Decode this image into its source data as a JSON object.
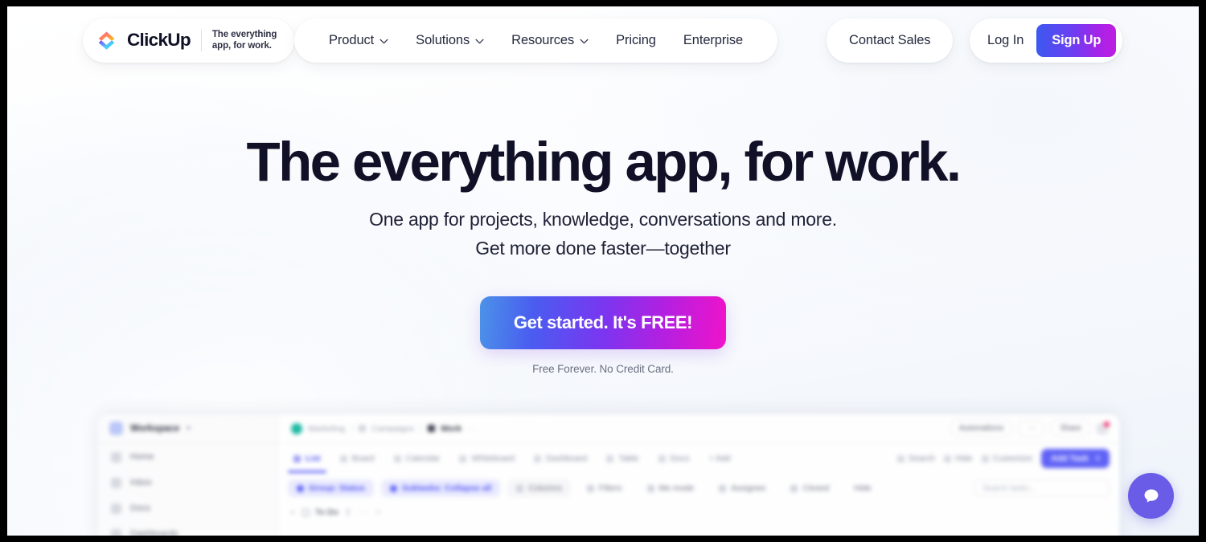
{
  "header": {
    "logo": {
      "icon": "clickup-logo-icon",
      "wordmark": "ClickUp",
      "tagline_line1": "The everything",
      "tagline_line2": "app, for work."
    },
    "nav_items": [
      {
        "label": "Product",
        "has_dropdown": true
      },
      {
        "label": "Solutions",
        "has_dropdown": true
      },
      {
        "label": "Resources",
        "has_dropdown": true
      },
      {
        "label": "Pricing",
        "has_dropdown": false
      },
      {
        "label": "Enterprise",
        "has_dropdown": false
      }
    ],
    "contact_sales": "Contact Sales",
    "log_in": "Log In",
    "sign_up": "Sign Up"
  },
  "hero": {
    "headline": "The everything app, for work.",
    "subhead_line1": "One app for projects, knowledge, conversations and more.",
    "subhead_line2": "Get more done faster—together",
    "cta_label": "Get started. It's FREE!",
    "cta_note": "Free Forever. No Credit Card."
  },
  "app_preview": {
    "workspace": {
      "name": "Workspace",
      "caret": "▾"
    },
    "sidebar_items": [
      {
        "label": "Home",
        "icon": "home-icon"
      },
      {
        "label": "Inbox",
        "icon": "inbox-icon"
      },
      {
        "label": "Docs",
        "icon": "docs-icon"
      },
      {
        "label": "Dashboards",
        "icon": "dashboards-icon"
      }
    ],
    "breadcrumb": [
      {
        "label": "Marketing",
        "bold": false
      },
      {
        "label": "Campaigns",
        "bold": false
      },
      {
        "label": "Work",
        "bold": true
      }
    ],
    "breadcrumb_separator": "/",
    "breadcrumb_more": "···",
    "header_actions": [
      {
        "label": "Automations"
      },
      {
        "label": "⋯"
      },
      {
        "label": "Share"
      }
    ],
    "tabs": [
      {
        "label": "List",
        "active": true
      },
      {
        "label": "Board",
        "active": false
      },
      {
        "label": "Calendar",
        "active": false
      },
      {
        "label": "Whiteboard",
        "active": false
      },
      {
        "label": "Dashboard",
        "active": false
      },
      {
        "label": "Table",
        "active": false
      },
      {
        "label": "Docs",
        "active": false
      }
    ],
    "add_view_label": "+ Add",
    "toolbar": [
      {
        "label": "Search",
        "icon": "search-icon"
      },
      {
        "label": "Hide",
        "icon": "hide-icon"
      },
      {
        "label": "Customize",
        "icon": "customize-icon"
      }
    ],
    "add_task_label": "Add Task",
    "add_task_caret": "▾",
    "filters": [
      {
        "label": "Group: Status",
        "style": "purple"
      },
      {
        "label": "Subtasks: Collapse all",
        "style": "purple"
      },
      {
        "label": "Columns",
        "style": "plain"
      },
      {
        "label": "Filters",
        "style": "plain"
      },
      {
        "label": "Me mode",
        "style": "plain"
      },
      {
        "label": "Assignee",
        "style": "plain"
      },
      {
        "label": "Closed",
        "style": "plain"
      },
      {
        "label": "Hide",
        "style": "bare"
      }
    ],
    "search_tasks_placeholder": "Search tasks...",
    "group_row": {
      "caret": "▾",
      "status": "To Do",
      "count": "2",
      "dots": "···",
      "plus": "+"
    }
  },
  "chat_widget": {
    "icon": "chat-bubble-icon",
    "label": "Open chat"
  },
  "colors": {
    "brand_dark": "#101127",
    "accent_blue": "#3c59f0",
    "accent_purple": "#6b5ce7",
    "accent_magenta": "#f013ca",
    "app_purple": "#5b5ef5",
    "teal": "#16b8a0"
  }
}
